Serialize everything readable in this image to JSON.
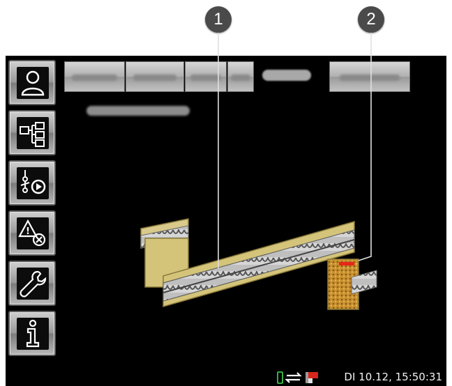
{
  "callouts": {
    "one": "1",
    "two": "2"
  },
  "nav": {
    "items": [
      {
        "name": "user",
        "icon": "user-icon"
      },
      {
        "name": "system-overview",
        "icon": "tree-structure-icon"
      },
      {
        "name": "sensors",
        "icon": "sensor-play-icon"
      },
      {
        "name": "alarms",
        "icon": "warning-cancel-icon"
      },
      {
        "name": "service",
        "icon": "wrench-icon"
      },
      {
        "name": "info",
        "icon": "info-icon"
      }
    ]
  },
  "status": {
    "datetime": "DI 10.12, 15:50:31",
    "icons": [
      "device-icon",
      "transfer-arrows-icon",
      "temperature-flag-icon"
    ]
  },
  "colors": {
    "background": "#000000",
    "button": "#a6a6a6",
    "callout": "#4a4a4a",
    "accent": "#e8261a"
  }
}
